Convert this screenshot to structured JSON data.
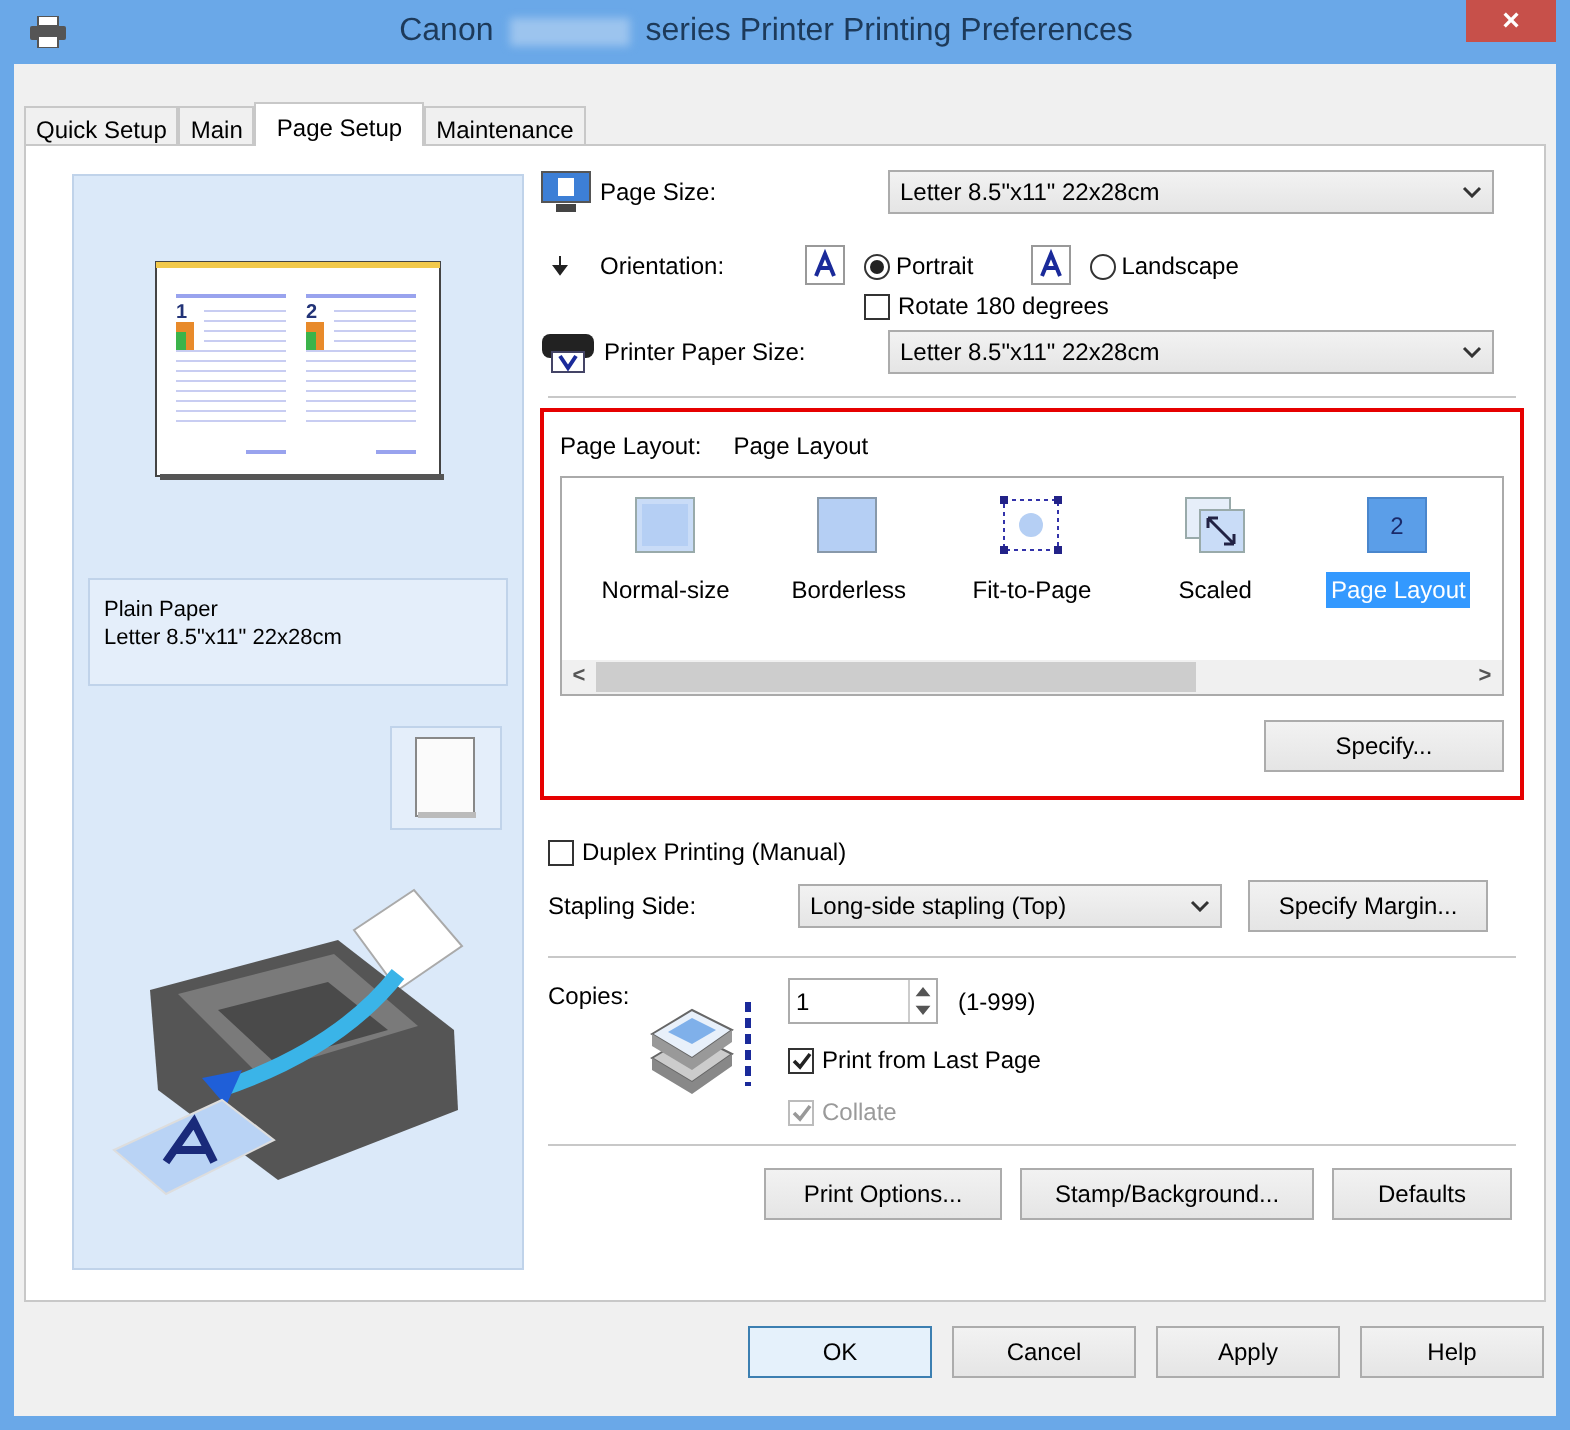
{
  "window": {
    "title_start": "Canon",
    "title_end": "series Printer Printing Preferences",
    "close": "×"
  },
  "tabs": [
    {
      "label": "Quick Setup",
      "selected": false
    },
    {
      "label": "Main",
      "selected": false
    },
    {
      "label": "Page Setup",
      "selected": true
    },
    {
      "label": "Maintenance",
      "selected": false
    }
  ],
  "preview": {
    "page_numbers": [
      "1",
      "2"
    ],
    "media": "Plain Paper",
    "size": "Letter 8.5\"x11\" 22x28cm"
  },
  "page_size": {
    "label": "Page Size:",
    "value": "Letter 8.5\"x11\" 22x28cm"
  },
  "orientation": {
    "label": "Orientation:",
    "options": [
      {
        "label": "Portrait",
        "selected": true
      },
      {
        "label": "Landscape",
        "selected": false
      }
    ]
  },
  "rotate": {
    "label": "Rotate 180 degrees",
    "checked": false
  },
  "printer_paper_size": {
    "label": "Printer Paper Size:",
    "value": "Letter 8.5\"x11\" 22x28cm"
  },
  "page_layout": {
    "label": "Page Layout:",
    "value": "Page Layout",
    "items": [
      {
        "kind": "normal",
        "label": "Normal-size",
        "selected": false
      },
      {
        "kind": "borderless",
        "label": "Borderless",
        "selected": false
      },
      {
        "kind": "fit",
        "label": "Fit-to-Page",
        "selected": false
      },
      {
        "kind": "scaled",
        "label": "Scaled",
        "selected": false
      },
      {
        "kind": "layout",
        "label": "Page Layout",
        "selected": true,
        "icon_text": "2"
      }
    ],
    "scroll_left": "<",
    "scroll_right": ">",
    "specify": "Specify..."
  },
  "duplex": {
    "label": "Duplex Printing (Manual)",
    "checked": false
  },
  "stapling_side": {
    "label": "Stapling Side:",
    "value": "Long-side stapling (Top)",
    "margin_button": "Specify Margin..."
  },
  "copies": {
    "label": "Copies:",
    "value": "1",
    "range": "(1-999)"
  },
  "copy_options": [
    {
      "label": "Print from Last Page",
      "checked": true,
      "disabled": false
    },
    {
      "label": "Collate",
      "checked": true,
      "disabled": true
    }
  ],
  "option_buttons": [
    "Print Options...",
    "Stamp/Background...",
    "Defaults"
  ],
  "dialog_buttons": [
    {
      "label": "OK",
      "default": true
    },
    {
      "label": "Cancel",
      "default": false
    },
    {
      "label": "Apply",
      "default": false
    },
    {
      "label": "Help",
      "default": false
    }
  ]
}
